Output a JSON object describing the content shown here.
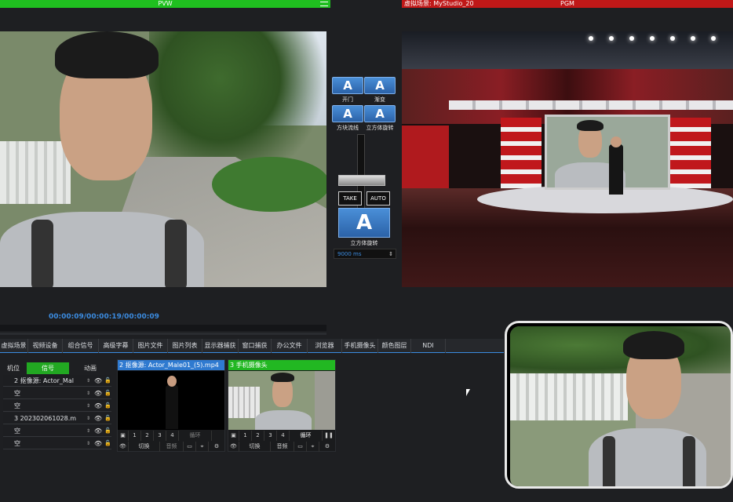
{
  "header": {
    "pvw_label": "PVW",
    "pgm_scene": "虚拟场景: MyStudio_20",
    "pgm_label": "PGM"
  },
  "transitions": {
    "buttons": [
      {
        "glyph": "A",
        "label": "开门"
      },
      {
        "glyph": "A",
        "label": "渐变"
      },
      {
        "glyph": "A",
        "label": "方块流线"
      },
      {
        "glyph": "A",
        "label": "立方体旋转"
      }
    ],
    "take_label": "TAKE",
    "auto_label": "AUTO",
    "current_glyph": "A",
    "current_label": "立方体旋转",
    "duration": "9000 ms"
  },
  "timeline": {
    "timecode": "00:00:09/00:00:19/00:00:09"
  },
  "tabs": [
    "虚拟场景",
    "视频设备",
    "组合信号",
    "高级字幕",
    "图片文件",
    "图片列表",
    "显示器捕获",
    "窗口捕获",
    "办公文件",
    "浏览器",
    "手机摄像头",
    "颜色图层",
    "NDI"
  ],
  "source_list": {
    "headers": [
      "机位",
      "信号",
      "动画"
    ],
    "rows": [
      {
        "text": "2 抠像源: Actor_Mal"
      },
      {
        "text": "空"
      },
      {
        "text": "空"
      },
      {
        "text": "3 202302061028.m"
      },
      {
        "text": "空"
      },
      {
        "text": "空"
      }
    ]
  },
  "cards": [
    {
      "title": "2 抠像源: Actor_Male01_(5).mp4",
      "header_color": "#2f7ad0",
      "nums": [
        "1",
        "2",
        "3",
        "4"
      ],
      "loop": "循环",
      "switch": "切换",
      "audio": "音频"
    },
    {
      "title": "3 手机摄像头",
      "header_color": "#22b822",
      "nums": [
        "1",
        "2",
        "3",
        "4"
      ],
      "loop": "循环",
      "switch": "切换",
      "audio": "音频"
    }
  ],
  "colors": {
    "pvw_bar": "#1fbf1f",
    "pgm_bar": "#c01818",
    "accent": "#3b8be0"
  }
}
